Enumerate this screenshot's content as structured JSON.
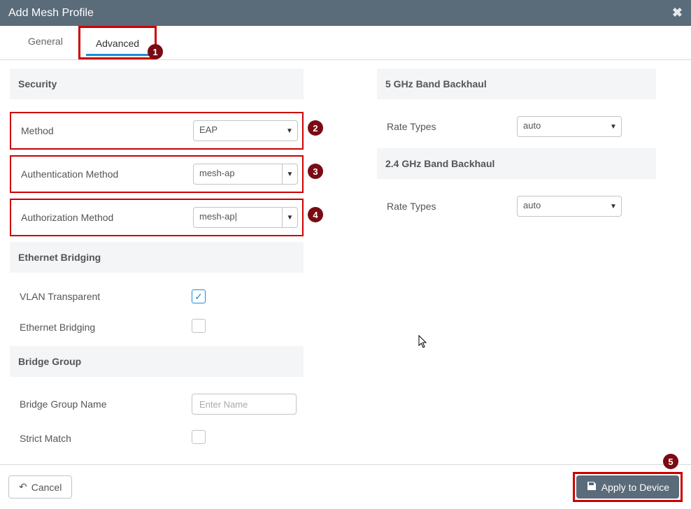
{
  "header": {
    "title": "Add Mesh Profile"
  },
  "tabs": [
    {
      "label": "General",
      "active": false
    },
    {
      "label": "Advanced",
      "active": true
    }
  ],
  "callouts": {
    "1": "1",
    "2": "2",
    "3": "3",
    "4": "4",
    "5": "5"
  },
  "left": {
    "security": {
      "title": "Security",
      "method_label": "Method",
      "method_value": "EAP",
      "auth_method_label": "Authentication Method",
      "auth_method_value": "mesh-ap",
      "authz_method_label": "Authorization Method",
      "authz_method_value": "mesh-ap|"
    },
    "ethernet_bridging": {
      "title": "Ethernet Bridging",
      "vlan_transparent_label": "VLAN Transparent",
      "vlan_transparent_checked": true,
      "ethernet_bridging_label": "Ethernet Bridging",
      "ethernet_bridging_checked": false
    },
    "bridge_group": {
      "title": "Bridge Group",
      "name_label": "Bridge Group Name",
      "name_placeholder": "Enter Name",
      "name_value": "",
      "strict_match_label": "Strict Match",
      "strict_match_checked": false
    }
  },
  "right": {
    "band5": {
      "title": "5 GHz Band Backhaul",
      "rate_types_label": "Rate Types",
      "rate_types_value": "auto"
    },
    "band24": {
      "title": "2.4 GHz Band Backhaul",
      "rate_types_label": "Rate Types",
      "rate_types_value": "auto"
    }
  },
  "footer": {
    "cancel_label": "Cancel",
    "apply_label": "Apply to Device"
  }
}
